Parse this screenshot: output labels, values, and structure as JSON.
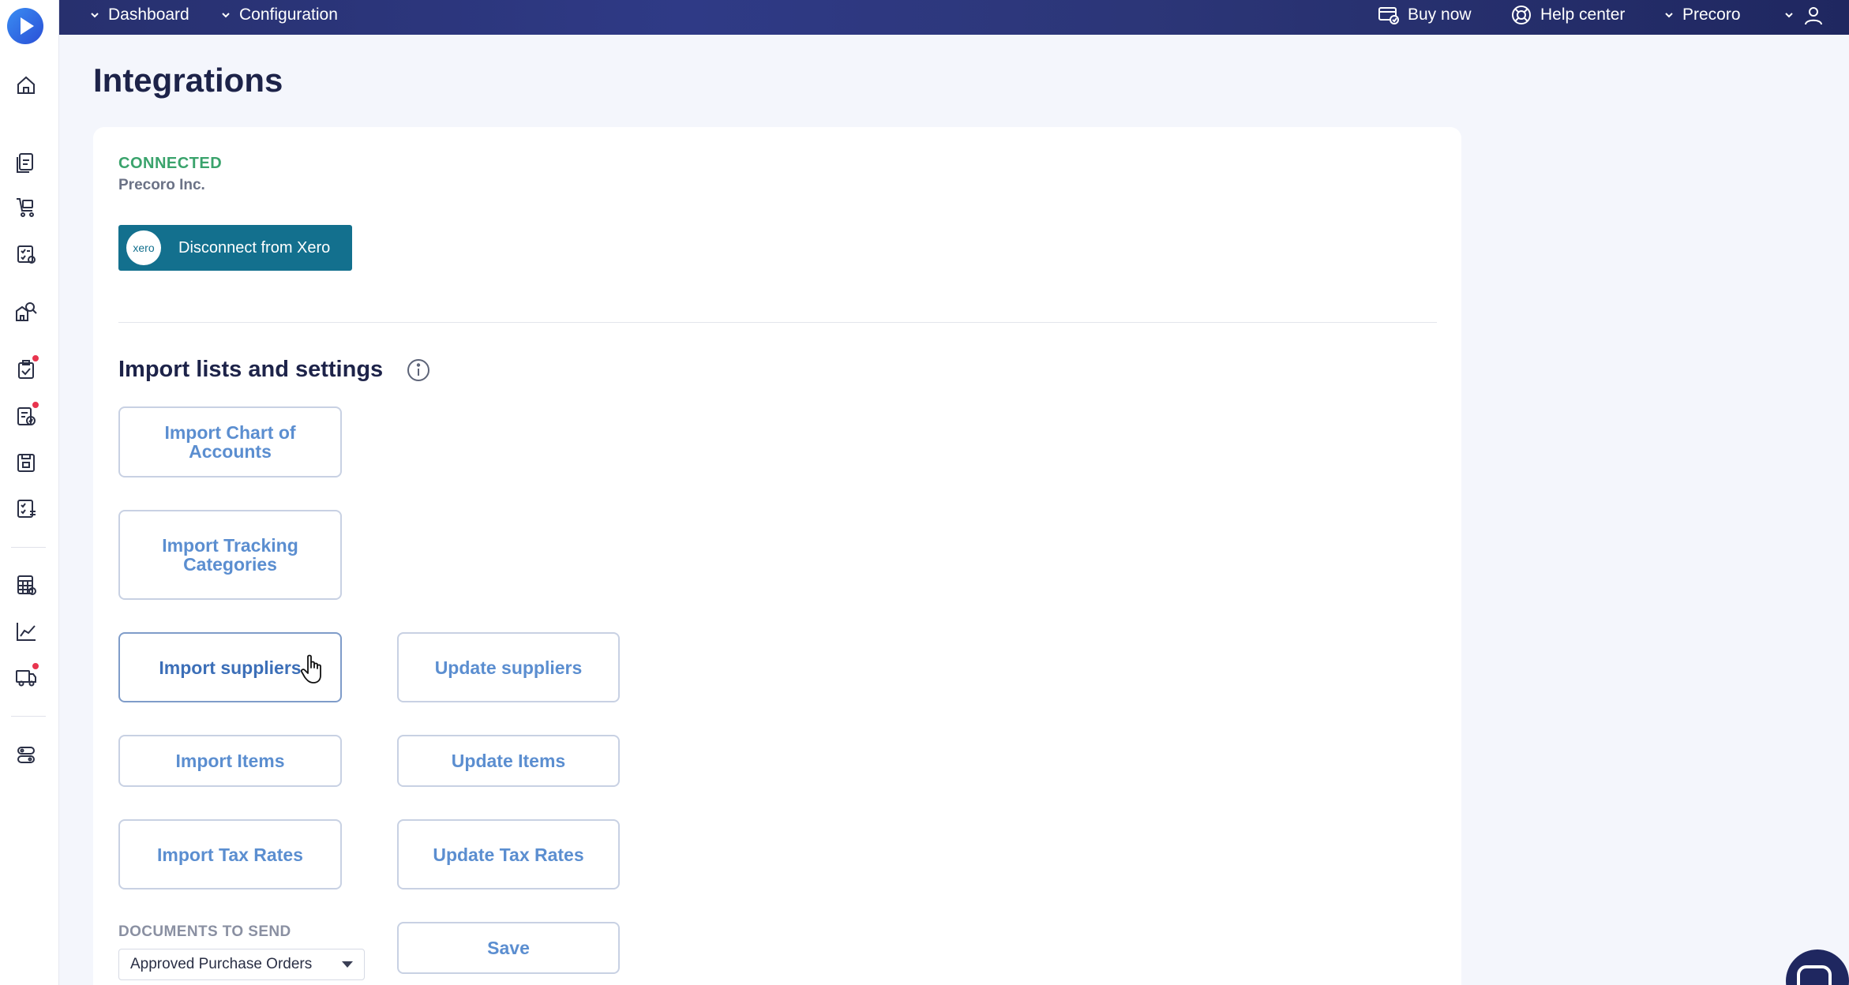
{
  "topbar": {
    "nav": [
      {
        "label": "Dashboard"
      },
      {
        "label": "Configuration"
      }
    ],
    "buy_now": "Buy now",
    "help_center": "Help center",
    "company_switch": "Precoro"
  },
  "page": {
    "title": "Integrations"
  },
  "connection": {
    "status": "CONNECTED",
    "company": "Precoro Inc.",
    "xero_logo_text": "xero",
    "disconnect_label": "Disconnect from Xero"
  },
  "import_section": {
    "title": "Import lists and settings",
    "buttons": {
      "import_chart": "Import Chart of Accounts",
      "import_tracking": "Import Tracking Categories",
      "import_suppliers": "Import suppliers",
      "update_suppliers": "Update suppliers",
      "import_items": "Import Items",
      "update_items": "Update Items",
      "import_tax": "Import Tax Rates",
      "update_tax": "Update Tax Rates",
      "save": "Save"
    },
    "documents_label": "DOCUMENTS TO SEND",
    "documents_selected": "Approved Purchase Orders"
  },
  "colors": {
    "topbar": "#2f3a86",
    "connected": "#3aa36c",
    "xero_button": "#13708e",
    "button_text": "#5b8ed0",
    "notification_dot": "#e8344e"
  },
  "icons": {
    "sidebar": [
      "home-icon",
      "documents-icon",
      "cart-icon",
      "receipt-icon",
      "supplier-search-icon",
      "approval-icon",
      "invoice-icon",
      "warehouse-icon",
      "checklist-icon",
      "budget-icon",
      "analytics-icon",
      "delivery-icon",
      "settings-icon"
    ]
  }
}
